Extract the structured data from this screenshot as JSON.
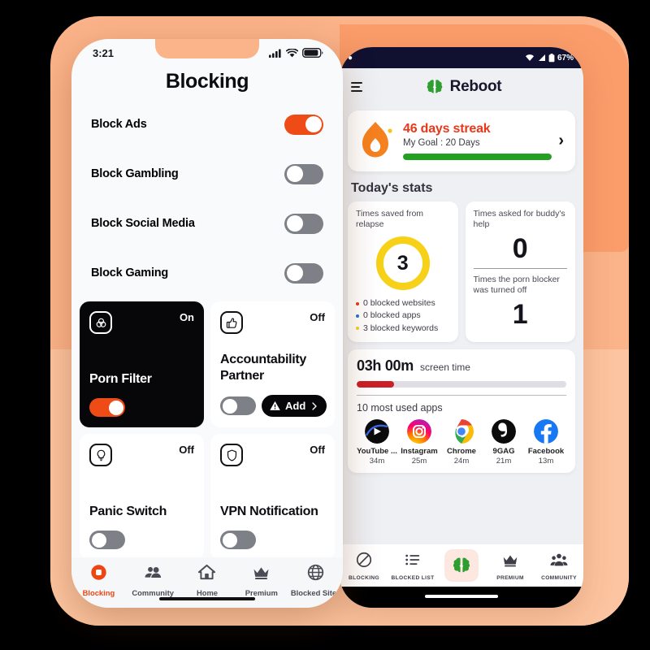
{
  "theme": {
    "accent_orange": "#ef4b16",
    "bg_peach": "#fbb389",
    "bg_peach_soft": "#fcc4a0",
    "bg_orange_block": "#fb9d6b",
    "green": "#23a021",
    "yellow": "#f7d117",
    "red": "#cb2026",
    "dark": "#07070a"
  },
  "left_phone": {
    "status": {
      "time": "3:21",
      "signal_icon": "signal-bars-icon",
      "wifi_icon": "wifi-icon",
      "battery_icon": "battery-icon"
    },
    "title": "Blocking",
    "toggles": [
      {
        "label": "Block Ads",
        "state": "on",
        "style": "dark"
      },
      {
        "label": "Block Gambling",
        "state": "off",
        "style": "light"
      },
      {
        "label": "Block Social Media",
        "state": "off",
        "style": "light"
      },
      {
        "label": "Block Gaming",
        "state": "off",
        "style": "light"
      }
    ],
    "cards": [
      {
        "title": "Porn Filter",
        "state_label": "On",
        "style": "dark",
        "icon": "venn-circles-icon",
        "toggle": "on",
        "has_add": false
      },
      {
        "title": "Accountability Partner",
        "state_label": "Off",
        "style": "light",
        "icon": "thumbs-up-icon",
        "toggle": "off",
        "has_add": true,
        "add_label": "Add"
      },
      {
        "title": "Panic Switch",
        "state_label": "Off",
        "style": "light",
        "icon": "lightbulb-icon",
        "toggle": "off",
        "has_add": false
      },
      {
        "title": "VPN Notification",
        "state_label": "Off",
        "style": "light",
        "icon": "shield-icon",
        "toggle": "off",
        "has_add": false
      }
    ],
    "nav": [
      {
        "label": "Blocking",
        "icon": "stop-square-icon",
        "active": true
      },
      {
        "label": "Community",
        "icon": "people-icon",
        "active": false
      },
      {
        "label": "Home",
        "icon": "house-icon",
        "active": false
      },
      {
        "label": "Premium",
        "icon": "crown-icon",
        "active": false
      },
      {
        "label": "Blocked Sites",
        "icon": "globe-icon",
        "active": false
      }
    ]
  },
  "right_phone": {
    "status": {
      "battery_percent": "67%",
      "wifi_icon": "wifi-icon",
      "signal_icon": "signal-icon",
      "battery_icon": "battery-icon"
    },
    "appbar": {
      "menu_icon": "hamburger-menu-icon",
      "brand": "Reboot",
      "brand_icon": "brain-icon"
    },
    "streak": {
      "icon": "flame-icon",
      "title": "46 days streak",
      "goal": "My Goal : 20 Days",
      "progress_percent": 100,
      "chevron": "›"
    },
    "stats_heading": "Today's stats",
    "stat_relapse": {
      "label": "Times saved from relapse",
      "value": "3",
      "breakdown": [
        {
          "text": "0 blocked websites",
          "color": "#e8381a"
        },
        {
          "text": "0 blocked apps",
          "color": "#2b6fd6"
        },
        {
          "text": "3 blocked keywords",
          "color": "#f7d117"
        }
      ]
    },
    "stat_buddy": {
      "label": "Times asked for buddy's help",
      "value": "0",
      "label2": "Times the porn blocker was turned off",
      "value2": "1"
    },
    "screen_time": {
      "value": "03h 00m",
      "label": "screen time",
      "progress_percent": 18,
      "apps_title": "10 most used apps",
      "apps": [
        {
          "name": "YouTube ...",
          "time": "34m",
          "icon": "youtube-icon"
        },
        {
          "name": "Instagram",
          "time": "25m",
          "icon": "instagram-icon"
        },
        {
          "name": "Chrome",
          "time": "24m",
          "icon": "chrome-icon"
        },
        {
          "name": "9GAG",
          "time": "21m",
          "icon": "ninegag-icon"
        },
        {
          "name": "Facebook",
          "time": "13m",
          "icon": "facebook-icon"
        }
      ]
    },
    "nav": [
      {
        "label": "BLOCKING",
        "icon": "no-entry-icon",
        "active": false
      },
      {
        "label": "BLOCKED LIST",
        "icon": "list-icon",
        "active": false
      },
      {
        "label": "",
        "icon": "brain-icon",
        "active": true
      },
      {
        "label": "PREMIUM",
        "icon": "crown-icon",
        "active": false
      },
      {
        "label": "COMMUNITY",
        "icon": "people-group-icon",
        "active": false
      }
    ]
  }
}
